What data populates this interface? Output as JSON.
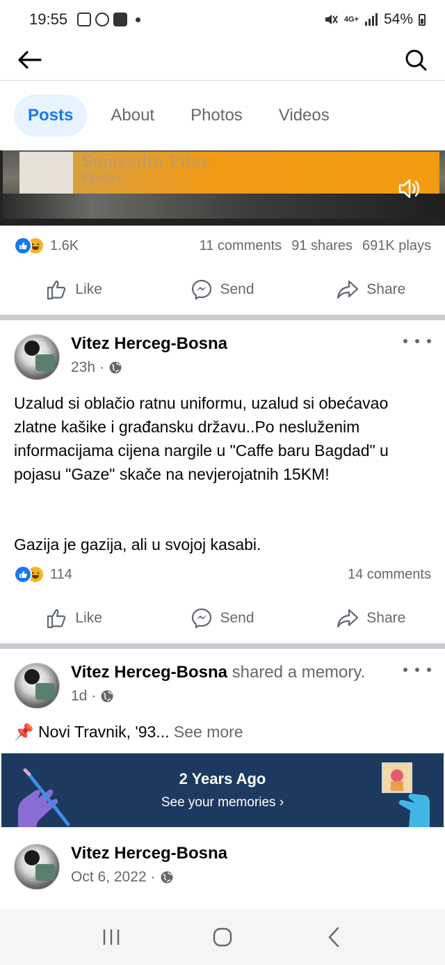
{
  "status_bar": {
    "time": "19:55",
    "network": "4G+",
    "battery": "54%"
  },
  "tabs": [
    {
      "label": "Posts",
      "active": true
    },
    {
      "label": "About",
      "active": false
    },
    {
      "label": "Photos",
      "active": false
    },
    {
      "label": "Videos",
      "active": false
    }
  ],
  "video": {
    "caption": "Šemsudin Pilav",
    "subcaption": "Pljučici"
  },
  "video_post": {
    "reactions": "1.6K",
    "comments": "11 comments",
    "shares": "91 shares",
    "plays": "691K plays"
  },
  "actions": {
    "like": "Like",
    "send": "Send",
    "share": "Share"
  },
  "post1": {
    "author": "Vitez Herceg-Bosna",
    "time": "23h",
    "text_p1": "Uzalud si oblačio ratnu uniformu, uzalud si obećavao zlatne kašike i građansku državu..Po nesluženim informacijama cijena nargile u \"Caffe baru Bagdad\" u pojasu \"Gaze\" skače na nevjerojatnih 15KM!",
    "text_p2": "Gazija je gazija, ali u svojoj kasabi.",
    "reactions": "114",
    "comments": "14 comments"
  },
  "post2": {
    "author": "Vitez Herceg-Bosna",
    "author_suffix": " shared a memory.",
    "time": "1d",
    "text": "Novi Travnik, '93...",
    "see_more": " See more",
    "pin_emoji": "📌"
  },
  "memory": {
    "title": "2 Years Ago",
    "subtitle": "See your memories ›"
  },
  "post3": {
    "author": "Vitez Herceg-Bosna",
    "time": "Oct 6, 2022"
  },
  "colors": {
    "accent": "#1877f2",
    "tab_active_bg": "#e7f3ff",
    "secondary_text": "#65676b",
    "memory_bg": "#1c3a5f"
  }
}
